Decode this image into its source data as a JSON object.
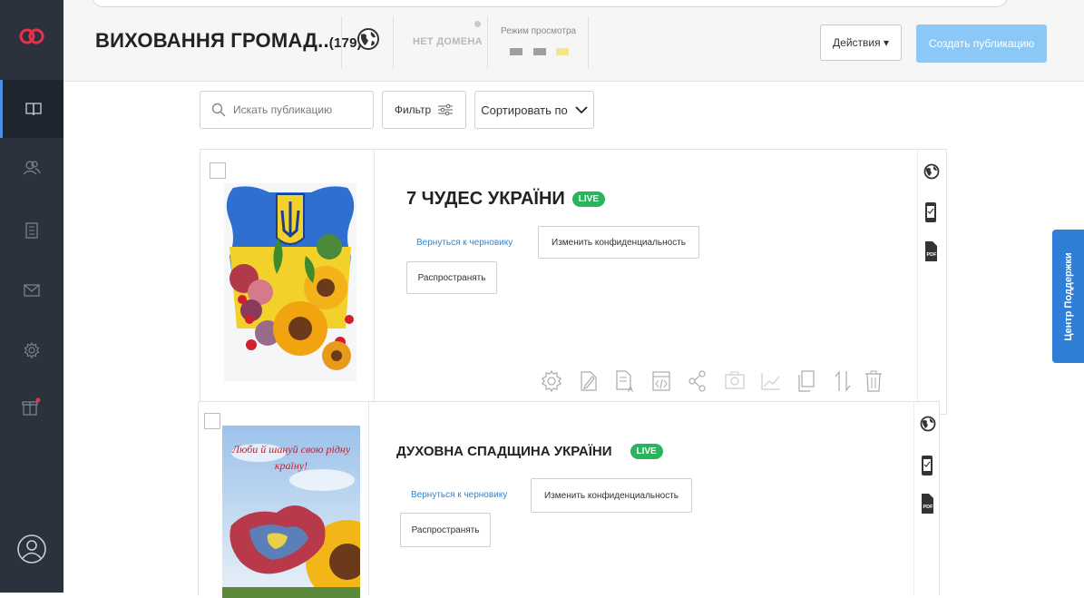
{
  "app": {
    "title": "ВИХОВАННЯ ГРОМАД..",
    "count": "(179)",
    "domain_label": "НЕТ ДОМЕНА",
    "view_mode_label": "Режим просмотра",
    "view_mode_swatches": [
      "#9e9e9e",
      "#9e9e9e",
      "#f7e58a"
    ],
    "accent": "#2f7fd9",
    "logo_color": "#e8314a"
  },
  "sidebar": {
    "items": [
      {
        "icon": "book-icon"
      },
      {
        "icon": "people-icon"
      },
      {
        "icon": "list-icon"
      },
      {
        "icon": "mail-icon"
      },
      {
        "icon": "gear-icon"
      },
      {
        "icon": "gift-icon"
      },
      {
        "icon": "profile-icon"
      }
    ]
  },
  "header": {
    "actions_label": "Действия ▾",
    "create_label": "Создать публикацию"
  },
  "toolbar": {
    "search_placeholder": "Искать публикацию",
    "filter_label": "Фильтр",
    "sort_label": "Сортировать по"
  },
  "publications": [
    {
      "title": "7 ЧУДЕС УКРАЇНИ",
      "status": "LIVE",
      "revert_link": "Вернуться к черновику",
      "privacy_button": "Изменить конфиденциальность",
      "share_button": "Распространять"
    },
    {
      "title": "ДУХОВНА СПАДЩИНА УКРАЇНИ",
      "status": "LIVE",
      "revert_link": "Вернуться к черновику",
      "privacy_button": "Изменить конфиденциальность",
      "share_button": "Распространять",
      "image_caption": "Люби й шануй свою рідну країну!"
    }
  ],
  "support": {
    "label": "Центр Поддержки"
  }
}
